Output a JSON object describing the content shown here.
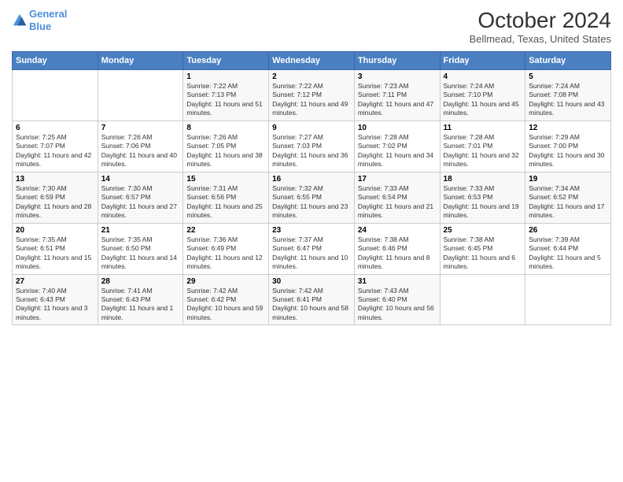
{
  "logo": {
    "line1": "General",
    "line2": "Blue"
  },
  "title": "October 2024",
  "subtitle": "Bellmead, Texas, United States",
  "days_of_week": [
    "Sunday",
    "Monday",
    "Tuesday",
    "Wednesday",
    "Thursday",
    "Friday",
    "Saturday"
  ],
  "weeks": [
    [
      {
        "day": "",
        "info": ""
      },
      {
        "day": "",
        "info": ""
      },
      {
        "day": "1",
        "info": "Sunrise: 7:22 AM\nSunset: 7:13 PM\nDaylight: 11 hours and 51 minutes."
      },
      {
        "day": "2",
        "info": "Sunrise: 7:22 AM\nSunset: 7:12 PM\nDaylight: 11 hours and 49 minutes."
      },
      {
        "day": "3",
        "info": "Sunrise: 7:23 AM\nSunset: 7:11 PM\nDaylight: 11 hours and 47 minutes."
      },
      {
        "day": "4",
        "info": "Sunrise: 7:24 AM\nSunset: 7:10 PM\nDaylight: 11 hours and 45 minutes."
      },
      {
        "day": "5",
        "info": "Sunrise: 7:24 AM\nSunset: 7:08 PM\nDaylight: 11 hours and 43 minutes."
      }
    ],
    [
      {
        "day": "6",
        "info": "Sunrise: 7:25 AM\nSunset: 7:07 PM\nDaylight: 11 hours and 42 minutes."
      },
      {
        "day": "7",
        "info": "Sunrise: 7:26 AM\nSunset: 7:06 PM\nDaylight: 11 hours and 40 minutes."
      },
      {
        "day": "8",
        "info": "Sunrise: 7:26 AM\nSunset: 7:05 PM\nDaylight: 11 hours and 38 minutes."
      },
      {
        "day": "9",
        "info": "Sunrise: 7:27 AM\nSunset: 7:03 PM\nDaylight: 11 hours and 36 minutes."
      },
      {
        "day": "10",
        "info": "Sunrise: 7:28 AM\nSunset: 7:02 PM\nDaylight: 11 hours and 34 minutes."
      },
      {
        "day": "11",
        "info": "Sunrise: 7:28 AM\nSunset: 7:01 PM\nDaylight: 11 hours and 32 minutes."
      },
      {
        "day": "12",
        "info": "Sunrise: 7:29 AM\nSunset: 7:00 PM\nDaylight: 11 hours and 30 minutes."
      }
    ],
    [
      {
        "day": "13",
        "info": "Sunrise: 7:30 AM\nSunset: 6:59 PM\nDaylight: 11 hours and 28 minutes."
      },
      {
        "day": "14",
        "info": "Sunrise: 7:30 AM\nSunset: 6:57 PM\nDaylight: 11 hours and 27 minutes."
      },
      {
        "day": "15",
        "info": "Sunrise: 7:31 AM\nSunset: 6:56 PM\nDaylight: 11 hours and 25 minutes."
      },
      {
        "day": "16",
        "info": "Sunrise: 7:32 AM\nSunset: 6:55 PM\nDaylight: 11 hours and 23 minutes."
      },
      {
        "day": "17",
        "info": "Sunrise: 7:33 AM\nSunset: 6:54 PM\nDaylight: 11 hours and 21 minutes."
      },
      {
        "day": "18",
        "info": "Sunrise: 7:33 AM\nSunset: 6:53 PM\nDaylight: 11 hours and 19 minutes."
      },
      {
        "day": "19",
        "info": "Sunrise: 7:34 AM\nSunset: 6:52 PM\nDaylight: 11 hours and 17 minutes."
      }
    ],
    [
      {
        "day": "20",
        "info": "Sunrise: 7:35 AM\nSunset: 6:51 PM\nDaylight: 11 hours and 15 minutes."
      },
      {
        "day": "21",
        "info": "Sunrise: 7:35 AM\nSunset: 6:50 PM\nDaylight: 11 hours and 14 minutes."
      },
      {
        "day": "22",
        "info": "Sunrise: 7:36 AM\nSunset: 6:49 PM\nDaylight: 11 hours and 12 minutes."
      },
      {
        "day": "23",
        "info": "Sunrise: 7:37 AM\nSunset: 6:47 PM\nDaylight: 11 hours and 10 minutes."
      },
      {
        "day": "24",
        "info": "Sunrise: 7:38 AM\nSunset: 6:46 PM\nDaylight: 11 hours and 8 minutes."
      },
      {
        "day": "25",
        "info": "Sunrise: 7:38 AM\nSunset: 6:45 PM\nDaylight: 11 hours and 6 minutes."
      },
      {
        "day": "26",
        "info": "Sunrise: 7:39 AM\nSunset: 6:44 PM\nDaylight: 11 hours and 5 minutes."
      }
    ],
    [
      {
        "day": "27",
        "info": "Sunrise: 7:40 AM\nSunset: 6:43 PM\nDaylight: 11 hours and 3 minutes."
      },
      {
        "day": "28",
        "info": "Sunrise: 7:41 AM\nSunset: 6:43 PM\nDaylight: 11 hours and 1 minute."
      },
      {
        "day": "29",
        "info": "Sunrise: 7:42 AM\nSunset: 6:42 PM\nDaylight: 10 hours and 59 minutes."
      },
      {
        "day": "30",
        "info": "Sunrise: 7:42 AM\nSunset: 6:41 PM\nDaylight: 10 hours and 58 minutes."
      },
      {
        "day": "31",
        "info": "Sunrise: 7:43 AM\nSunset: 6:40 PM\nDaylight: 10 hours and 56 minutes."
      },
      {
        "day": "",
        "info": ""
      },
      {
        "day": "",
        "info": ""
      }
    ]
  ]
}
